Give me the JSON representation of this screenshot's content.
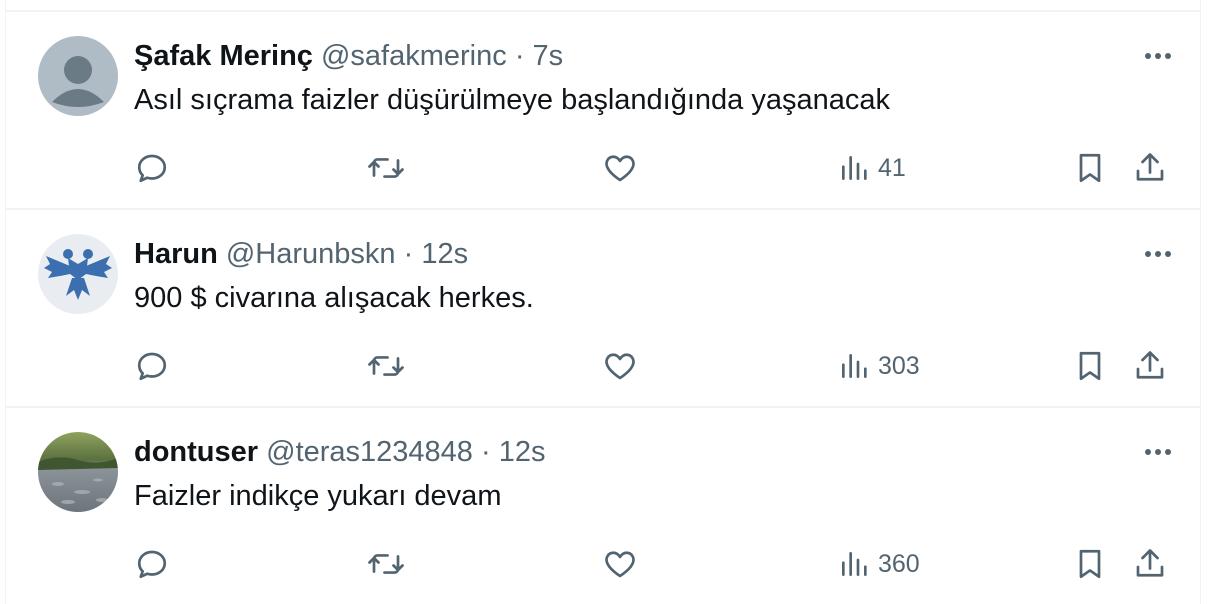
{
  "tweets": [
    {
      "name": "Şafak Merinç",
      "handle": "@safakmerinc",
      "time": "· 7s",
      "text": "Asıl sıçrama faizler düşürülmeye başlandığında yaşanacak",
      "views": "41",
      "avatar": "default-avatar-icon"
    },
    {
      "name": "Harun",
      "handle": "@Harunbskn",
      "time": "· 12s",
      "text": "900 $ civarına alışacak herkes.",
      "views": "303",
      "avatar": "double-headed-eagle-emblem"
    },
    {
      "name": "dontuser",
      "handle": "@teras1234848",
      "time": "· 12s",
      "text": "Faizler indikçe yukarı devam",
      "views": "360",
      "avatar": "river-landscape-photo"
    }
  ],
  "colors": {
    "text_primary": "#0f1419",
    "text_secondary": "#536471",
    "border": "#eff3f4",
    "eagle_blue": "#3b6fb0"
  }
}
